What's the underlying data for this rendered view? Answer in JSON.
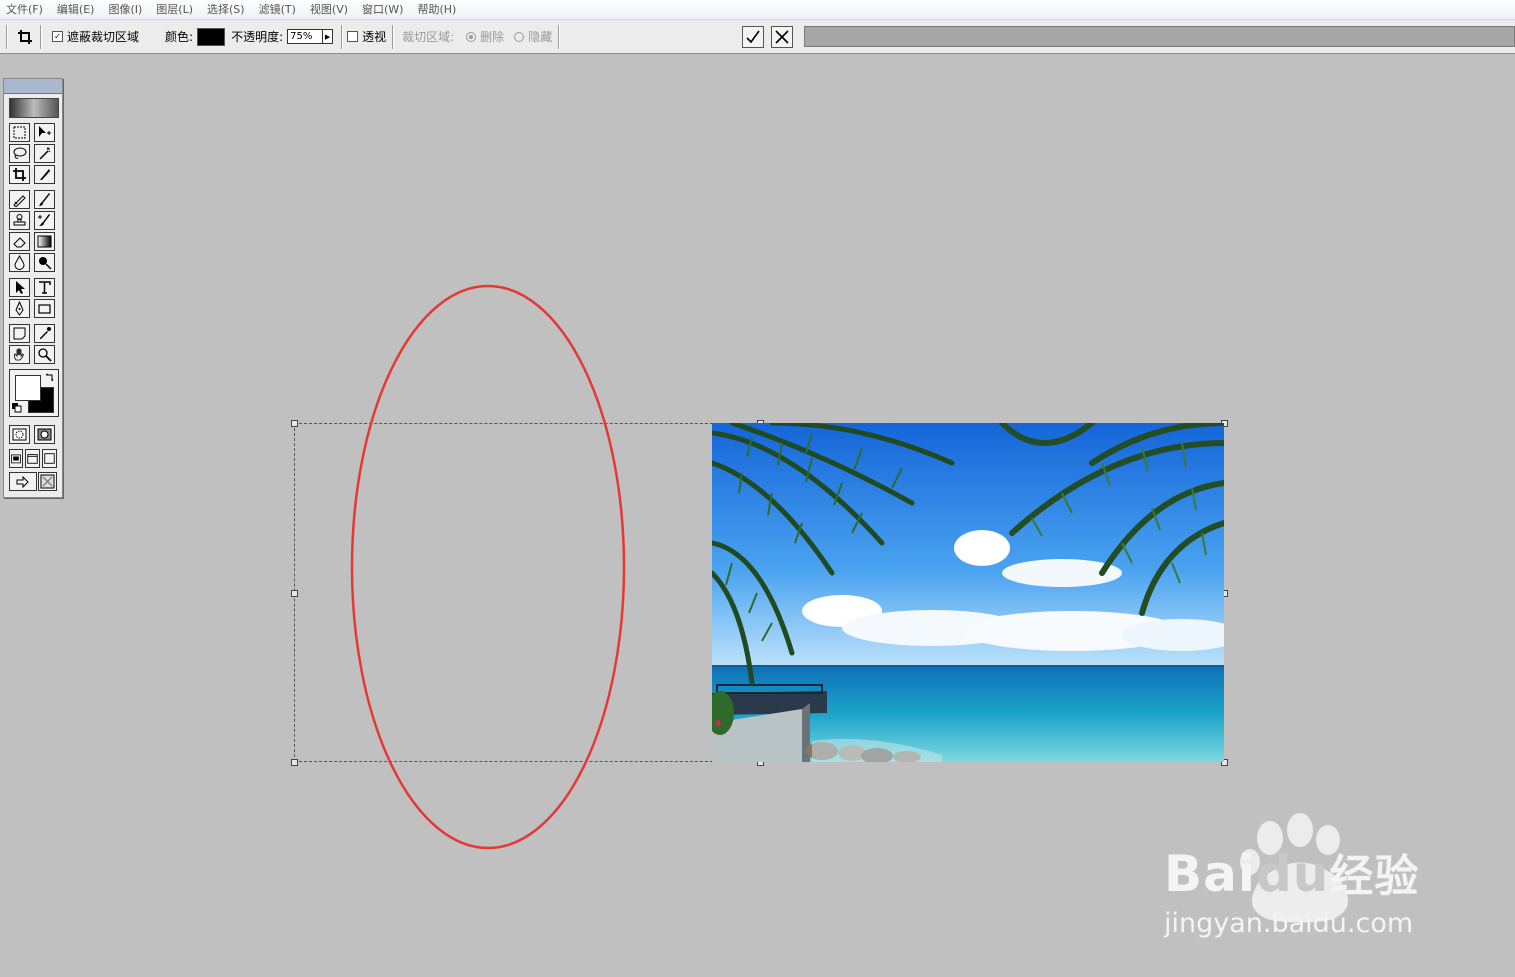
{
  "menu": [
    "文件(F)",
    "编辑(E)",
    "图像(I)",
    "图层(L)",
    "选择(S)",
    "滤镜(T)",
    "视图(V)",
    "窗口(W)",
    "帮助(H)"
  ],
  "options": {
    "shield_label": "遮蔽裁切区域",
    "shield_checked": true,
    "color_label": "颜色:",
    "color_value": "#000000",
    "opacity_label": "不透明度:",
    "opacity_value": "75%",
    "perspective_label": "透视",
    "perspective_checked": false,
    "crop_area_label": "裁切区域:",
    "delete_label": "删除",
    "hide_label": "隐藏",
    "confirm_icon": "checkmark-icon",
    "cancel_icon": "cancel-x-icon"
  },
  "canvas": {
    "background": "#c0c0c0",
    "annotation_color": "#e53935"
  },
  "watermark": {
    "brand": "Bai",
    "brand2": "du",
    "suffix": "经验",
    "url": "jingyan.baidu.com"
  }
}
